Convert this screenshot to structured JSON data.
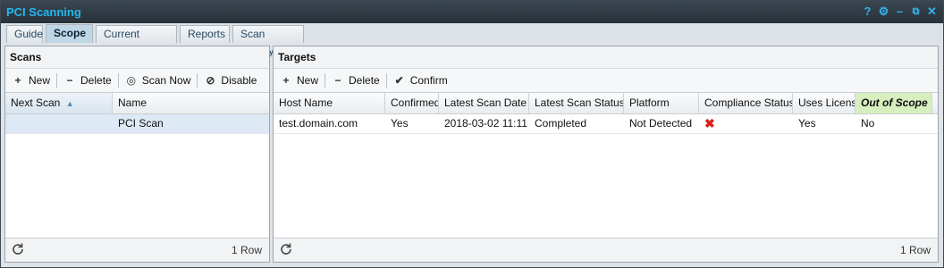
{
  "window": {
    "title": "PCI Scanning"
  },
  "tabs": [
    "Guide",
    "Scope",
    "Current Activity",
    "Reports",
    "Scan History"
  ],
  "scans": {
    "title": "Scans",
    "toolbar": {
      "new": "New",
      "delete": "Delete",
      "scan_now": "Scan Now",
      "disable": "Disable"
    },
    "columns": [
      "Next Scan",
      "Name"
    ],
    "rows": [
      {
        "next_scan": "",
        "name": "PCI Scan"
      }
    ],
    "row_count": "1 Row"
  },
  "targets": {
    "title": "Targets",
    "toolbar": {
      "new": "New",
      "delete": "Delete",
      "confirm": "Confirm"
    },
    "columns": [
      "Host Name",
      "Confirmed",
      "Latest Scan Date",
      "Latest Scan Status",
      "Platform",
      "Compliance Status",
      "Uses License",
      "Out of Scope"
    ],
    "rows": [
      {
        "host": "test.domain.com",
        "confirmed": "Yes",
        "date": "2018-03-02 11:11",
        "status": "Completed",
        "platform": "Not Detected",
        "compliance_icon": "red-x-icon",
        "uses_license": "Yes",
        "out_of_scope": "No"
      }
    ],
    "row_count": "1 Row"
  },
  "colors": {
    "title_text": "#22b8f0",
    "active_tab": "#bfd6e6",
    "out_of_scope_header": "#d7eebf",
    "error": "#d8231d"
  }
}
